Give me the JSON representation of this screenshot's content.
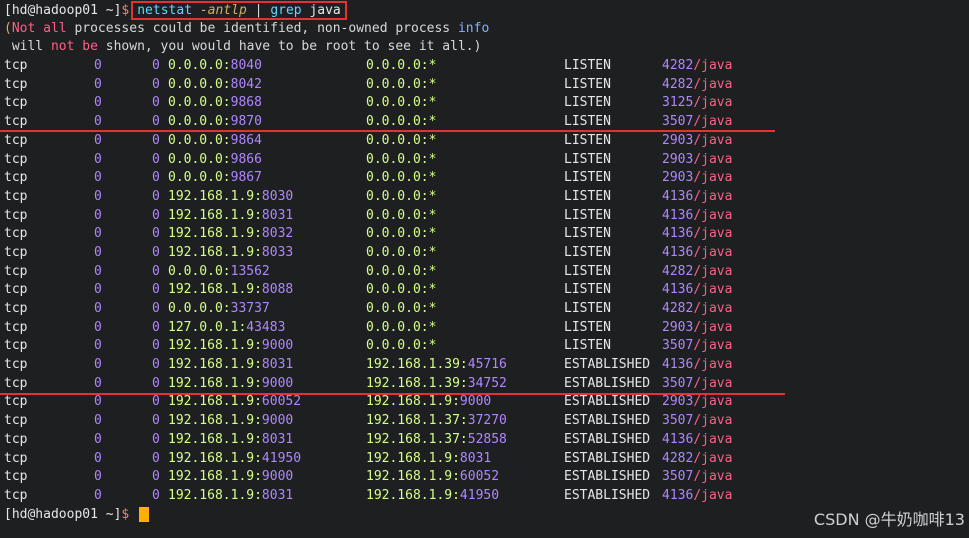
{
  "prompt": {
    "user_host": "[hd@hadoop01 ~]",
    "symbol": "$"
  },
  "command": {
    "name": "netstat",
    "flag": "-antlp",
    "pipe": "|",
    "grep": "grep",
    "arg": "java"
  },
  "warning": {
    "line1": {
      "open_paren": "(",
      "neg": "Not all",
      "mid": " processes could be identified, non-owned process ",
      "info": "info"
    },
    "line2": {
      "pre": " will ",
      "neg": "not be",
      "post": " shown, you would have to be root to see it all.)"
    }
  },
  "rows": [
    {
      "proto": "tcp",
      "recv": "0",
      "send": "0",
      "local_ip": "0.0.0.0",
      "local_port": "8040",
      "foreign_ip": "0.0.0.0",
      "foreign_port": "*",
      "state": "LISTEN",
      "pid": "4282",
      "prog": "java"
    },
    {
      "proto": "tcp",
      "recv": "0",
      "send": "0",
      "local_ip": "0.0.0.0",
      "local_port": "8042",
      "foreign_ip": "0.0.0.0",
      "foreign_port": "*",
      "state": "LISTEN",
      "pid": "4282",
      "prog": "java"
    },
    {
      "proto": "tcp",
      "recv": "0",
      "send": "0",
      "local_ip": "0.0.0.0",
      "local_port": "9868",
      "foreign_ip": "0.0.0.0",
      "foreign_port": "*",
      "state": "LISTEN",
      "pid": "3125",
      "prog": "java"
    },
    {
      "proto": "tcp",
      "recv": "0",
      "send": "0",
      "local_ip": "0.0.0.0",
      "local_port": "9870",
      "foreign_ip": "0.0.0.0",
      "foreign_port": "*",
      "state": "LISTEN",
      "pid": "3507",
      "prog": "java"
    },
    {
      "proto": "tcp",
      "recv": "0",
      "send": "0",
      "local_ip": "0.0.0.0",
      "local_port": "9864",
      "foreign_ip": "0.0.0.0",
      "foreign_port": "*",
      "state": "LISTEN",
      "pid": "2903",
      "prog": "java"
    },
    {
      "proto": "tcp",
      "recv": "0",
      "send": "0",
      "local_ip": "0.0.0.0",
      "local_port": "9866",
      "foreign_ip": "0.0.0.0",
      "foreign_port": "*",
      "state": "LISTEN",
      "pid": "2903",
      "prog": "java"
    },
    {
      "proto": "tcp",
      "recv": "0",
      "send": "0",
      "local_ip": "0.0.0.0",
      "local_port": "9867",
      "foreign_ip": "0.0.0.0",
      "foreign_port": "*",
      "state": "LISTEN",
      "pid": "2903",
      "prog": "java"
    },
    {
      "proto": "tcp",
      "recv": "0",
      "send": "0",
      "local_ip": "192.168.1.9",
      "local_port": "8030",
      "foreign_ip": "0.0.0.0",
      "foreign_port": "*",
      "state": "LISTEN",
      "pid": "4136",
      "prog": "java"
    },
    {
      "proto": "tcp",
      "recv": "0",
      "send": "0",
      "local_ip": "192.168.1.9",
      "local_port": "8031",
      "foreign_ip": "0.0.0.0",
      "foreign_port": "*",
      "state": "LISTEN",
      "pid": "4136",
      "prog": "java"
    },
    {
      "proto": "tcp",
      "recv": "0",
      "send": "0",
      "local_ip": "192.168.1.9",
      "local_port": "8032",
      "foreign_ip": "0.0.0.0",
      "foreign_port": "*",
      "state": "LISTEN",
      "pid": "4136",
      "prog": "java"
    },
    {
      "proto": "tcp",
      "recv": "0",
      "send": "0",
      "local_ip": "192.168.1.9",
      "local_port": "8033",
      "foreign_ip": "0.0.0.0",
      "foreign_port": "*",
      "state": "LISTEN",
      "pid": "4136",
      "prog": "java"
    },
    {
      "proto": "tcp",
      "recv": "0",
      "send": "0",
      "local_ip": "0.0.0.0",
      "local_port": "13562",
      "foreign_ip": "0.0.0.0",
      "foreign_port": "*",
      "state": "LISTEN",
      "pid": "4282",
      "prog": "java"
    },
    {
      "proto": "tcp",
      "recv": "0",
      "send": "0",
      "local_ip": "192.168.1.9",
      "local_port": "8088",
      "foreign_ip": "0.0.0.0",
      "foreign_port": "*",
      "state": "LISTEN",
      "pid": "4136",
      "prog": "java"
    },
    {
      "proto": "tcp",
      "recv": "0",
      "send": "0",
      "local_ip": "0.0.0.0",
      "local_port": "33737",
      "foreign_ip": "0.0.0.0",
      "foreign_port": "*",
      "state": "LISTEN",
      "pid": "4282",
      "prog": "java"
    },
    {
      "proto": "tcp",
      "recv": "0",
      "send": "0",
      "local_ip": "127.0.0.1",
      "local_port": "43483",
      "foreign_ip": "0.0.0.0",
      "foreign_port": "*",
      "state": "LISTEN",
      "pid": "2903",
      "prog": "java"
    },
    {
      "proto": "tcp",
      "recv": "0",
      "send": "0",
      "local_ip": "192.168.1.9",
      "local_port": "9000",
      "foreign_ip": "0.0.0.0",
      "foreign_port": "*",
      "state": "LISTEN",
      "pid": "3507",
      "prog": "java"
    },
    {
      "proto": "tcp",
      "recv": "0",
      "send": "0",
      "local_ip": "192.168.1.9",
      "local_port": "8031",
      "foreign_ip": "192.168.1.39",
      "foreign_port": "45716",
      "state": "ESTABLISHED",
      "pid": "4136",
      "prog": "java"
    },
    {
      "proto": "tcp",
      "recv": "0",
      "send": "0",
      "local_ip": "192.168.1.9",
      "local_port": "9000",
      "foreign_ip": "192.168.1.39",
      "foreign_port": "34752",
      "state": "ESTABLISHED",
      "pid": "3507",
      "prog": "java"
    },
    {
      "proto": "tcp",
      "recv": "0",
      "send": "0",
      "local_ip": "192.168.1.9",
      "local_port": "60052",
      "foreign_ip": "192.168.1.9",
      "foreign_port": "9000",
      "state": "ESTABLISHED",
      "pid": "2903",
      "prog": "java"
    },
    {
      "proto": "tcp",
      "recv": "0",
      "send": "0",
      "local_ip": "192.168.1.9",
      "local_port": "9000",
      "foreign_ip": "192.168.1.37",
      "foreign_port": "37270",
      "state": "ESTABLISHED",
      "pid": "3507",
      "prog": "java"
    },
    {
      "proto": "tcp",
      "recv": "0",
      "send": "0",
      "local_ip": "192.168.1.9",
      "local_port": "8031",
      "foreign_ip": "192.168.1.37",
      "foreign_port": "52858",
      "state": "ESTABLISHED",
      "pid": "4136",
      "prog": "java"
    },
    {
      "proto": "tcp",
      "recv": "0",
      "send": "0",
      "local_ip": "192.168.1.9",
      "local_port": "41950",
      "foreign_ip": "192.168.1.9",
      "foreign_port": "8031",
      "state": "ESTABLISHED",
      "pid": "4282",
      "prog": "java"
    },
    {
      "proto": "tcp",
      "recv": "0",
      "send": "0",
      "local_ip": "192.168.1.9",
      "local_port": "9000",
      "foreign_ip": "192.168.1.9",
      "foreign_port": "60052",
      "state": "ESTABLISHED",
      "pid": "3507",
      "prog": "java"
    },
    {
      "proto": "tcp",
      "recv": "0",
      "send": "0",
      "local_ip": "192.168.1.9",
      "local_port": "8031",
      "foreign_ip": "192.168.1.9",
      "foreign_port": "41950",
      "state": "ESTABLISHED",
      "pid": "4136",
      "prog": "java"
    }
  ],
  "watermark": "CSDN @牛奶咖啡13",
  "colors": {
    "highlight": "#e03434",
    "cursor": "#ffb000",
    "background": "#1d1f21"
  }
}
